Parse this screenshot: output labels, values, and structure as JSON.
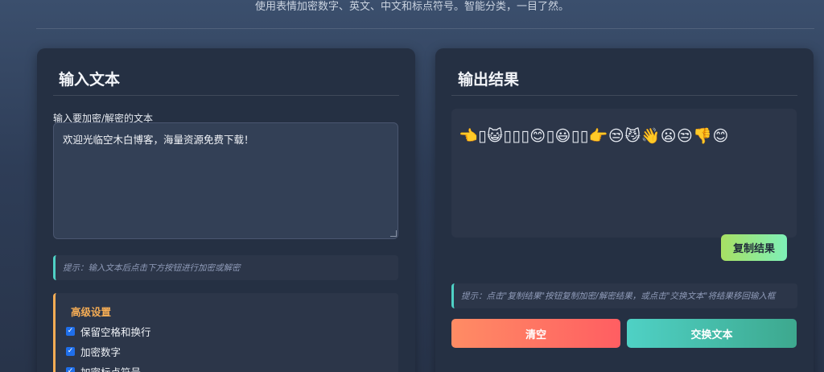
{
  "header": {
    "subtitle": "使用表情加密数字、英文、中文和标点符号。智能分类，一目了然。"
  },
  "input_panel": {
    "title": "输入文本",
    "field_label": "输入要加密/解密的文本",
    "input_value": "欢迎光临空木白博客，海量资源免费下载！",
    "hint": "提示：输入文本后点击下方按钮进行加密或解密"
  },
  "advanced_settings": {
    "title": "高级设置",
    "options": [
      {
        "label": "保留空格和换行",
        "checked": true
      },
      {
        "label": "加密数字",
        "checked": true
      },
      {
        "label": "加密标点符号",
        "checked": true
      }
    ]
  },
  "output_panel": {
    "title": "输出结果",
    "result": "👈▯😺▯▯▯😊▯😃▯▯👉😒😼👋😦😒👎😊",
    "copy_button": "复制结果",
    "hint": "提示：点击\"复制结果\"按钮复制加密/解密结果，或点击\"交换文本\"将结果移回输入框",
    "clear_button": "清空",
    "swap_button": "交换文本"
  },
  "colors": {
    "accent_teal": "#4fd1c5",
    "accent_orange": "#f6ad55",
    "clear_gradient_start": "#ff8c64",
    "clear_gradient_end": "#ff5e62",
    "copy_gradient_start": "#a8e063",
    "copy_gradient_end": "#7ef0b8"
  }
}
